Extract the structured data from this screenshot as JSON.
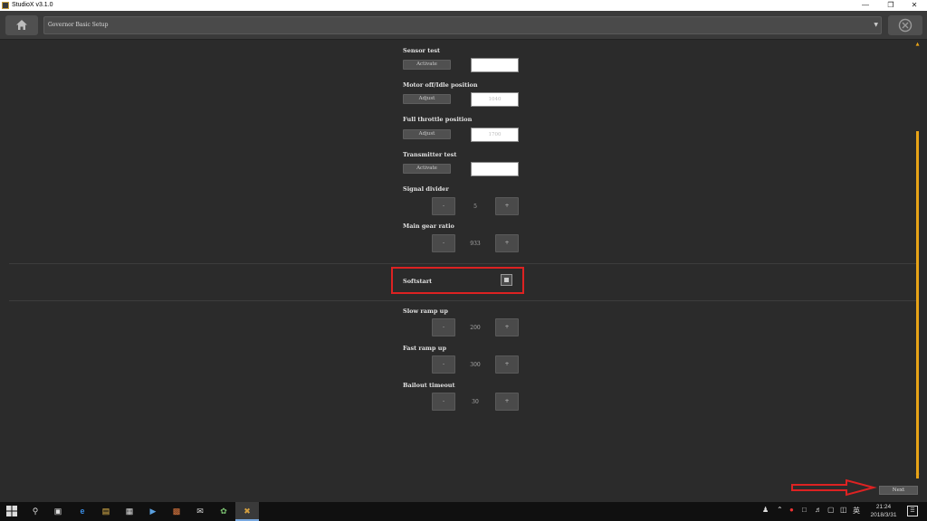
{
  "window": {
    "title": "StudioX v3.1.0"
  },
  "toolbar": {
    "breadcrumb": "Governor Basic Setup"
  },
  "settings": [
    {
      "label": "Sensor test",
      "button": "Activate",
      "value": ""
    },
    {
      "label": "Motor off/Idle position",
      "button": "Adjust",
      "value": "1040"
    },
    {
      "label": "Full throttle position",
      "button": "Adjust",
      "value": "1700"
    },
    {
      "label": "Transmitter test",
      "button": "Activate",
      "value": ""
    }
  ],
  "steppers_top": [
    {
      "label": "Signal divider",
      "value": "5",
      "minus": "-",
      "plus": "+"
    },
    {
      "label": "Main gear ratio",
      "value": "933",
      "minus": "-",
      "plus": "+"
    }
  ],
  "softstart": {
    "label": "Softstart",
    "checked": true
  },
  "steppers_bottom": [
    {
      "label": "Slow ramp up",
      "value": "200",
      "minus": "-",
      "plus": "+"
    },
    {
      "label": "Fast ramp up",
      "value": "300",
      "minus": "-",
      "plus": "+"
    },
    {
      "label": "Bailout timeout",
      "value": "30",
      "minus": "-",
      "plus": "+"
    }
  ],
  "footer": {
    "next_label": "Next"
  },
  "taskbar": {
    "time": "21:24",
    "date": "2018/3/31",
    "language": "英"
  },
  "colors": {
    "accent": "#e8a317",
    "highlight": "#dd2222",
    "background": "#2b2b2b"
  }
}
